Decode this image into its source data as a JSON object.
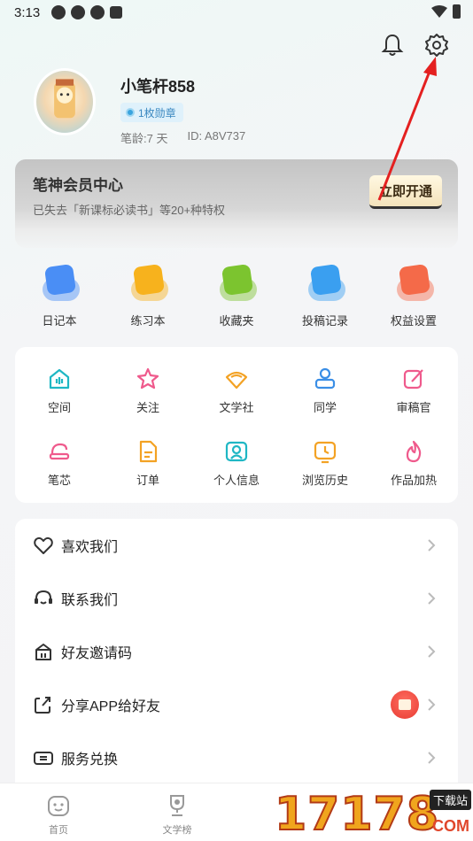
{
  "status_bar": {
    "time": "3:13"
  },
  "header": {
    "bell_icon": "bell-icon",
    "settings_icon": "gear-icon"
  },
  "profile": {
    "name": "小笔杆858",
    "badge": "1枚勋章",
    "age": "笔龄:7 天",
    "id": "ID: A8V737"
  },
  "vip": {
    "title": "笔神会员中心",
    "subtitle": "已失去「新课标必读书」等20+种特权",
    "button": "立即开通"
  },
  "quick_actions": [
    {
      "label": "日记本",
      "color": "#4a8ef5",
      "icon": "diary-icon"
    },
    {
      "label": "练习本",
      "color": "#f7b21d",
      "icon": "exercise-book-icon"
    },
    {
      "label": "收藏夹",
      "color": "#7cc42f",
      "icon": "favorites-icon"
    },
    {
      "label": "投稿记录",
      "color": "#3a9ff0",
      "icon": "submission-icon"
    },
    {
      "label": "权益设置",
      "color": "#f46a49",
      "icon": "benefits-icon"
    }
  ],
  "grid": [
    {
      "label": "空间",
      "color": "#1fb7c4",
      "icon": "space-icon"
    },
    {
      "label": "关注",
      "color": "#ef5a8c",
      "icon": "follow-icon"
    },
    {
      "label": "文学社",
      "color": "#f3a224",
      "icon": "literary-club-icon"
    },
    {
      "label": "同学",
      "color": "#3a8ee6",
      "icon": "classmates-icon"
    },
    {
      "label": "审稿官",
      "color": "#ef5a8c",
      "icon": "reviewer-icon"
    },
    {
      "label": "笔芯",
      "color": "#ef5a8c",
      "icon": "pen-refill-icon"
    },
    {
      "label": "订单",
      "color": "#f3a224",
      "icon": "order-icon"
    },
    {
      "label": "个人信息",
      "color": "#1fb7c4",
      "icon": "personal-info-icon"
    },
    {
      "label": "浏览历史",
      "color": "#f3a224",
      "icon": "history-icon"
    },
    {
      "label": "作品加热",
      "color": "#ef5a8c",
      "icon": "boost-icon"
    }
  ],
  "menu": [
    {
      "label": "喜欢我们",
      "icon": "heart-icon"
    },
    {
      "label": "联系我们",
      "icon": "headset-icon"
    },
    {
      "label": "好友邀请码",
      "icon": "invite-code-icon"
    },
    {
      "label": "分享APP给好友",
      "icon": "share-icon"
    },
    {
      "label": "服务兑换",
      "icon": "redeem-icon"
    }
  ],
  "tabs": [
    {
      "label": "首页",
      "icon": "home-icon"
    },
    {
      "label": "文学榜",
      "icon": "trophy-icon"
    }
  ],
  "watermark": {
    "digits": "17178",
    "tag": "下载站",
    "domain": "COM"
  }
}
